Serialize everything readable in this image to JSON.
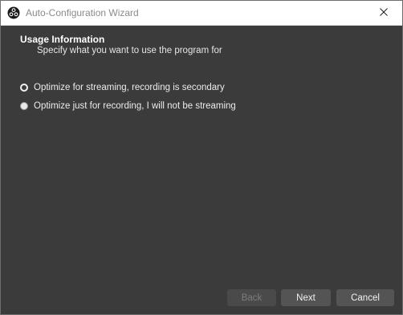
{
  "window": {
    "title": "Auto-Configuration Wizard",
    "app_icon": "obs-logo-icon",
    "close_icon": "close-icon"
  },
  "page": {
    "heading": "Usage Information",
    "subheading": "Specify what you want to use the program for"
  },
  "options": [
    {
      "label": "Optimize for streaming, recording is secondary",
      "selected": true
    },
    {
      "label": "Optimize just for recording, I will not be streaming",
      "selected": false
    }
  ],
  "buttons": {
    "back": "Back",
    "next": "Next",
    "cancel": "Cancel"
  },
  "colors": {
    "background": "#3b3b3b",
    "titlebar": "#ffffff",
    "button": "#545454",
    "button_disabled": "#4a4a4a"
  }
}
